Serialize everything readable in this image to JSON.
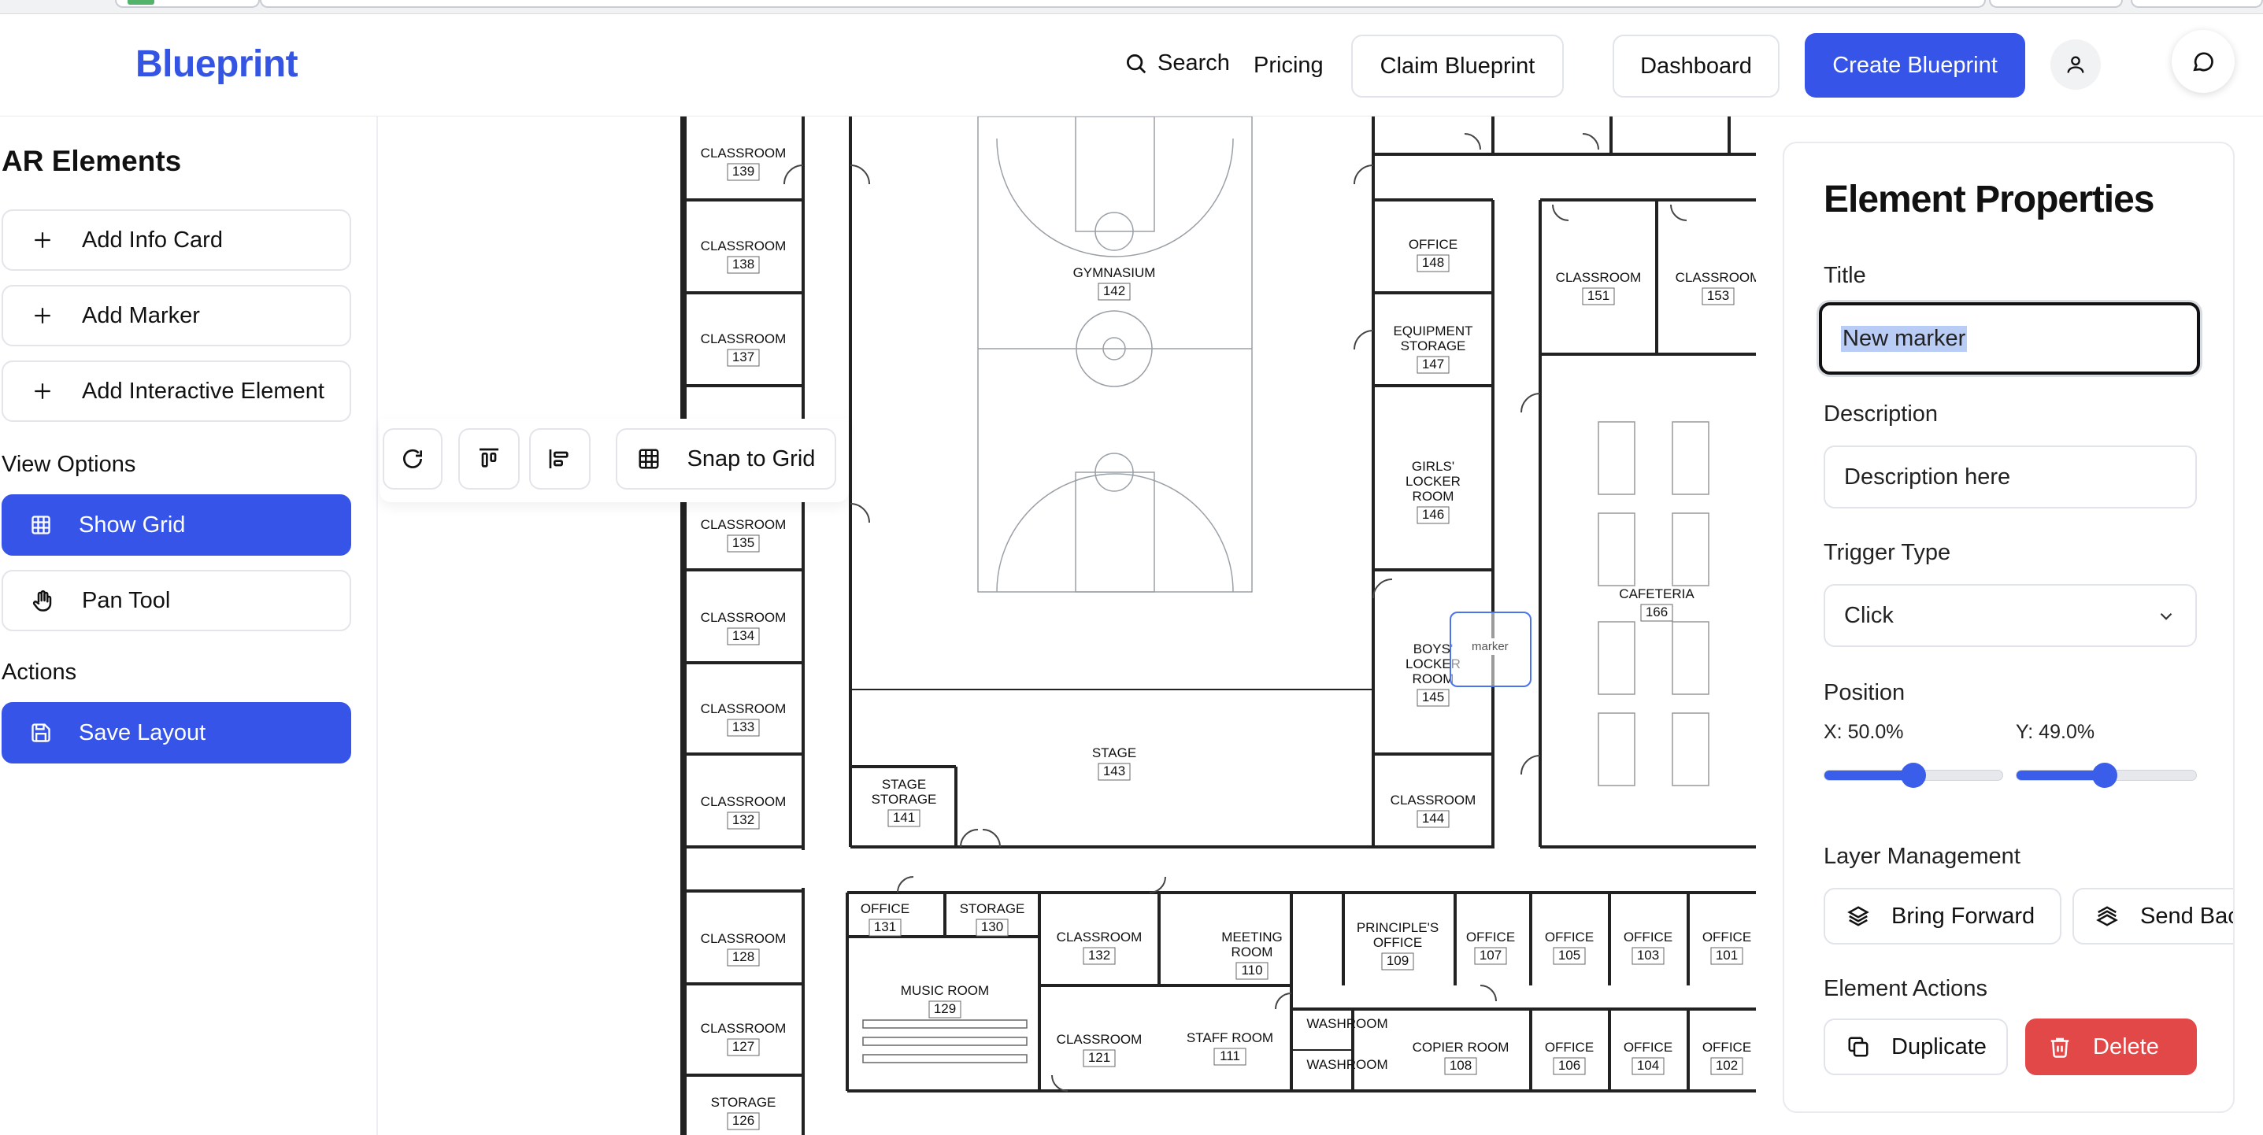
{
  "header": {
    "logo": "Blueprint",
    "search_label": "Search",
    "pricing_label": "Pricing",
    "claim_label": "Claim Blueprint",
    "dashboard_label": "Dashboard",
    "create_label": "Create Blueprint"
  },
  "sidebar": {
    "title": "AR Elements",
    "add_buttons": [
      "Add Info Card",
      "Add Marker",
      "Add Interactive Element"
    ],
    "view_options_label": "View Options",
    "show_grid_label": "Show Grid",
    "pan_tool_label": "Pan Tool",
    "actions_label": "Actions",
    "save_label": "Save Layout"
  },
  "toolbar": {
    "snap_label": "Snap to Grid"
  },
  "floorplan": {
    "rooms": [
      {
        "name": "CLASSROOM",
        "num": "139"
      },
      {
        "name": "CLASSROOM",
        "num": "138"
      },
      {
        "name": "CLASSROOM",
        "num": "137"
      },
      {
        "name": "CLASSROOM",
        "num": "135"
      },
      {
        "name": "CLASSROOM",
        "num": "134"
      },
      {
        "name": "CLASSROOM",
        "num": "133"
      },
      {
        "name": "CLASSROOM",
        "num": "132"
      },
      {
        "name": "CLASSROOM",
        "num": "128"
      },
      {
        "name": "CLASSROOM",
        "num": "127"
      },
      {
        "name": "STORAGE",
        "num": "126"
      },
      {
        "name": "GYMNASIUM",
        "num": "142"
      },
      {
        "name": "STAGE",
        "num": "143"
      },
      {
        "name": "STAGE STORAGE",
        "num": "141"
      },
      {
        "name": "OFFICE",
        "num": "148"
      },
      {
        "name": "EQUIPMENT STORAGE",
        "num": "147"
      },
      {
        "name": "GIRLS' LOCKER ROOM",
        "num": "146"
      },
      {
        "name": "BOYS' LOCKER ROOM",
        "num": "145"
      },
      {
        "name": "CLASSROOM",
        "num": "144"
      },
      {
        "name": "CLASSROOM",
        "num": "151"
      },
      {
        "name": "CLASSROOM",
        "num": "153"
      },
      {
        "name": "CAFETERIA",
        "num": "166"
      },
      {
        "name": "OFFICE",
        "num": "131"
      },
      {
        "name": "STORAGE",
        "num": "130"
      },
      {
        "name": "MUSIC ROOM",
        "num": "129"
      },
      {
        "name": "CLASSROOM",
        "num": "132"
      },
      {
        "name": "CLASSROOM",
        "num": "121"
      },
      {
        "name": "MEETING ROOM",
        "num": "110"
      },
      {
        "name": "STAFF ROOM",
        "num": "111"
      },
      {
        "name": "PRINCIPLE'S OFFICE",
        "num": "109"
      },
      {
        "name": "OFFICE",
        "num": "107"
      },
      {
        "name": "OFFICE",
        "num": "105"
      },
      {
        "name": "OFFICE",
        "num": "103"
      },
      {
        "name": "OFFICE",
        "num": "101"
      },
      {
        "name": "WASHROOM",
        "num": ""
      },
      {
        "name": "WASHROOM",
        "num": ""
      },
      {
        "name": "COPIER ROOM",
        "num": "108"
      },
      {
        "name": "OFFICE",
        "num": "106"
      },
      {
        "name": "OFFICE",
        "num": "104"
      },
      {
        "name": "OFFICE",
        "num": "102"
      }
    ],
    "marker_label": "marker"
  },
  "properties": {
    "title": "Element Properties",
    "title_label": "Title",
    "title_value": "New marker",
    "description_label": "Description",
    "description_value": "Description here",
    "trigger_label": "Trigger Type",
    "trigger_value": "Click",
    "position_label": "Position",
    "x_label": "X: 50.0%",
    "y_label": "Y: 49.0%",
    "x_value": 0.5,
    "y_value": 0.49,
    "layer_label": "Layer Management",
    "bring_forward_label": "Bring Forward",
    "send_backward_label": "Send Backward",
    "element_actions_label": "Element Actions",
    "duplicate_label": "Duplicate",
    "delete_label": "Delete"
  },
  "colors": {
    "brand": "#3454e4",
    "primary_button": "#3654e8",
    "danger": "#e34848",
    "selection": "#b9ccf5"
  }
}
